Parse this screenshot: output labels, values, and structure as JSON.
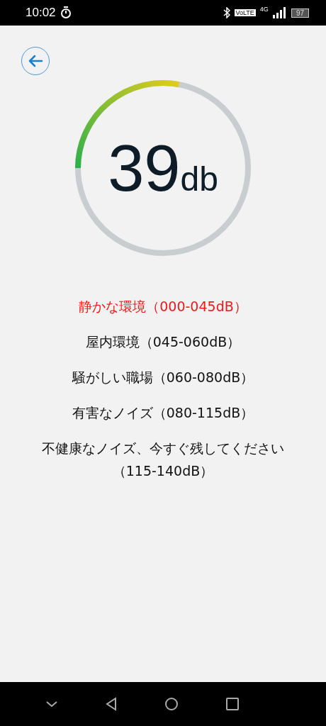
{
  "status_bar": {
    "time": "10:02",
    "volte": "VoLTE",
    "network": "4G",
    "battery": "97"
  },
  "meter": {
    "value": "39",
    "unit": "db"
  },
  "ranges": [
    {
      "label": "静かな環境（000-045dB）",
      "selected": true
    },
    {
      "label": "屋内環境（045-060dB）",
      "selected": false
    },
    {
      "label": "騒がしい職場（060-080dB）",
      "selected": false
    },
    {
      "label": "有害なノイズ（080-115dB）",
      "selected": false
    },
    {
      "label": "不健康なノイズ、今すぐ残してください（115-140dB）",
      "selected": false
    }
  ]
}
